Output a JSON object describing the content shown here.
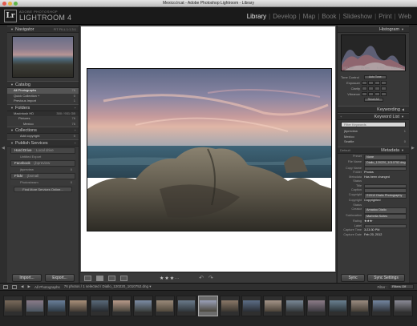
{
  "window": {
    "title": "Mexico.lrcat - Adobe Photoshop Lightroom - Library"
  },
  "brand": {
    "small": "ADOBE PHOTOSHOP",
    "big": "LIGHTROOM 4",
    "badge": "Lr"
  },
  "modules": [
    {
      "label": "Library",
      "active": true
    },
    {
      "label": "Develop"
    },
    {
      "label": "Map"
    },
    {
      "label": "Book"
    },
    {
      "label": "Slideshow"
    },
    {
      "label": "Print"
    },
    {
      "label": "Web"
    }
  ],
  "navigator": {
    "title": "Navigator",
    "zoom": "FIT FILL 1:1 3:1"
  },
  "catalog": {
    "title": "Catalog",
    "items": [
      {
        "label": "All Photographs",
        "count": "76"
      },
      {
        "label": "Quick Collection +",
        "count": "0"
      },
      {
        "label": "Previous Import",
        "count": "1"
      }
    ]
  },
  "folders": {
    "title": "Folders",
    "volume": {
      "label": "Macintosh HD",
      "info": "300 / 931 GB"
    },
    "items": [
      {
        "label": "Pictures",
        "count": "76"
      },
      {
        "label": "Mexico",
        "count": "76"
      }
    ]
  },
  "collections": {
    "title": "Collections",
    "items": [
      {
        "label": "Add copyright",
        "count": "0"
      }
    ]
  },
  "publish": {
    "title": "Publish Services",
    "services": [
      {
        "name": "Hard Drive",
        "sub": ": Local drive",
        "children": [
          {
            "label": "Untitled Export",
            "count": ""
          }
        ]
      },
      {
        "name": "Facebook",
        "sub": ": jbpreview",
        "children": [
          {
            "label": "jbpreview",
            "count": "0"
          }
        ]
      },
      {
        "name": "Flickr",
        "sub": ": jbsmall",
        "children": [
          {
            "label": "Photostream",
            "count": "0"
          }
        ]
      }
    ],
    "find_more": "Find More Services Online..."
  },
  "left_buttons": {
    "import": "Import...",
    "export": "Export..."
  },
  "right": {
    "histogram": {
      "title": "Histogram",
      "info": [
        "ISO 200",
        "21 mm",
        "f / 4.0",
        "1/160 sec"
      ]
    },
    "quick_develop": {
      "preset": "Saved Preset",
      "label": "Tone Control",
      "auto": "Auto Tone",
      "rows": [
        "Exposure",
        "Clarity",
        "Vibrance"
      ],
      "reset": "Reset All"
    },
    "keywording": {
      "title": "Keywording"
    },
    "keyword_list": {
      "title": "Keyword List",
      "filter_placeholder": "Filter Keywords",
      "items": [
        {
          "label": "jbpreview",
          "count": "1"
        },
        {
          "label": "Mexico",
          "count": ""
        },
        {
          "label": "Seattle",
          "count": "0"
        }
      ]
    },
    "metadata": {
      "title": "Metadata",
      "default": "Default",
      "preset_label": "Preset",
      "preset_value": "None",
      "rows": [
        {
          "k": "File Name",
          "v": "Diallo_120220_1010752.dng",
          "box": true
        },
        {
          "k": "Copy Name",
          "v": "",
          "box": true
        },
        {
          "k": "Folder",
          "v": "Photos",
          "box": false
        },
        {
          "k": "Metadata Status",
          "v": "Has been changed",
          "box": false
        },
        {
          "k": "Title",
          "v": "",
          "box": true
        },
        {
          "k": "Caption",
          "v": "",
          "box": true
        },
        {
          "k": "Copyright",
          "v": "©2012 Diallo Photography",
          "box": true
        },
        {
          "k": "Copyright Status",
          "v": "Copyrighted",
          "box": false
        },
        {
          "k": "Creator",
          "v": "Amadou Diallo",
          "box": true
        },
        {
          "k": "Sublocation",
          "v": "Marbella Suites",
          "box": true
        },
        {
          "k": "Rating",
          "v": "★★★·",
          "box": false
        },
        {
          "k": "Label",
          "v": "",
          "box": true
        },
        {
          "k": "Capture Time",
          "v": "3:23:30 PM",
          "box": false
        },
        {
          "k": "Capture Date",
          "v": "Feb 20, 2012",
          "box": false
        }
      ]
    },
    "sync": {
      "sync": "Sync",
      "settings": "Sync Settings"
    }
  },
  "toolbar": {
    "stars": "★★★··"
  },
  "filmstrip": {
    "breadcrumb": "All Photographs",
    "status": "76 photos / 1 selected / Diallo_120220_1010752.dng ▾",
    "filter_label": "Filter :",
    "filter_value": "Filters Off",
    "selected_index": 9,
    "count": 19
  }
}
